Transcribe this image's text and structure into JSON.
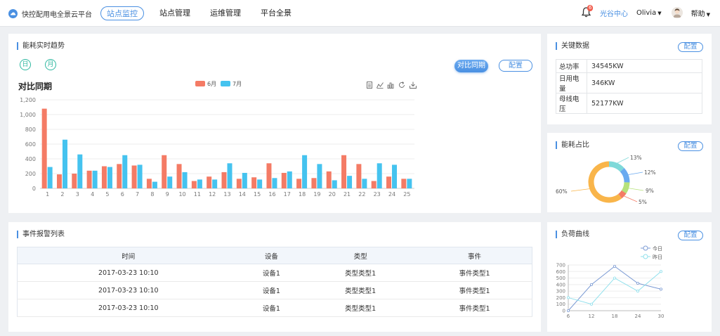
{
  "app": {
    "title": "快控配用电全景云平台"
  },
  "nav": [
    {
      "label": "站点监控",
      "active": true
    },
    {
      "label": "站点管理",
      "active": false
    },
    {
      "label": "运维管理",
      "active": false
    },
    {
      "label": "平台全景",
      "active": false
    }
  ],
  "header": {
    "badge": "6",
    "light_center": "光谷中心",
    "user": "Olivia",
    "help": "帮助"
  },
  "trend": {
    "title": "能耗实时趋势",
    "day_btn": "日",
    "month_btn": "月",
    "compare_btn": "对比同期",
    "config_btn": "配置",
    "chart_title": "对比同期"
  },
  "key_data": {
    "title": "关键数据",
    "config_btn": "配置",
    "rows": [
      {
        "label": "总功率",
        "value": "34545KW"
      },
      {
        "label": "日用电量",
        "value": "346KW"
      },
      {
        "label": "母线电压",
        "value": "52177KW"
      }
    ]
  },
  "ratio": {
    "title": "能耗占比",
    "config_btn": "配置"
  },
  "events": {
    "title": "事件报警列表",
    "columns": [
      "时间",
      "设备",
      "类型",
      "事件"
    ],
    "rows": [
      [
        "2017-03-23 10:10",
        "设备1",
        "类型类型1",
        "事件类型1"
      ],
      [
        "2017-03-23 10:10",
        "设备1",
        "类型类型1",
        "事件类型1"
      ],
      [
        "2017-03-23 10:10",
        "设备1",
        "类型类型1",
        "事件类型1"
      ]
    ]
  },
  "load": {
    "title": "负荷曲线",
    "config_btn": "配置"
  },
  "colors": {
    "accent": "#4a90e2",
    "june": "#f47b65",
    "july": "#45c3ef",
    "teal": "#2fb8a0"
  },
  "chart_data": [
    {
      "type": "bar",
      "title": "对比同期",
      "categories": [
        "1",
        "2",
        "3",
        "4",
        "5",
        "6",
        "7",
        "8",
        "9",
        "10",
        "11",
        "12",
        "13",
        "14",
        "15",
        "16",
        "17",
        "18",
        "19",
        "20",
        "21",
        "22",
        "23",
        "24",
        "25"
      ],
      "series": [
        {
          "name": "6月",
          "values": [
            1080,
            190,
            200,
            240,
            300,
            330,
            310,
            130,
            450,
            330,
            100,
            160,
            220,
            130,
            150,
            340,
            210,
            130,
            140,
            230,
            450,
            330,
            100,
            160,
            130
          ]
        },
        {
          "name": "7月",
          "values": [
            290,
            660,
            460,
            240,
            290,
            450,
            320,
            90,
            160,
            220,
            120,
            120,
            340,
            210,
            120,
            140,
            230,
            450,
            330,
            110,
            170,
            130,
            340,
            320,
            130
          ]
        }
      ],
      "ylim": [
        0,
        1200
      ],
      "yticks": [
        "0",
        "200",
        "400",
        "600",
        "800",
        "1,000",
        "1,200"
      ],
      "legend": "top-center",
      "grid": true
    },
    {
      "type": "pie",
      "slices": [
        {
          "label": "13%",
          "value": 13,
          "color": "#7ed9d9"
        },
        {
          "label": "12%",
          "value": 12,
          "color": "#6aaaf0"
        },
        {
          "label": "9%",
          "value": 9,
          "color": "#b6e27a"
        },
        {
          "label": "5%",
          "value": 5,
          "color": "#f47b65"
        },
        {
          "label": "60%",
          "value": 60,
          "color": "#f9b54a"
        }
      ]
    },
    {
      "type": "line",
      "x": [
        6,
        12,
        18,
        24,
        30
      ],
      "series": [
        {
          "name": "今日",
          "values": [
            0,
            400,
            680,
            420,
            330
          ],
          "color": "#7c9bd4"
        },
        {
          "name": "昨日",
          "values": [
            200,
            100,
            500,
            300,
            600
          ],
          "color": "#8fe0ec"
        }
      ],
      "ylim": [
        0,
        700
      ],
      "yticks": [
        "0",
        "100",
        "200",
        "300",
        "400",
        "500",
        "600",
        "700"
      ],
      "xticks": [
        "6",
        "12",
        "18",
        "24",
        "30"
      ],
      "legend": "top-right"
    }
  ]
}
